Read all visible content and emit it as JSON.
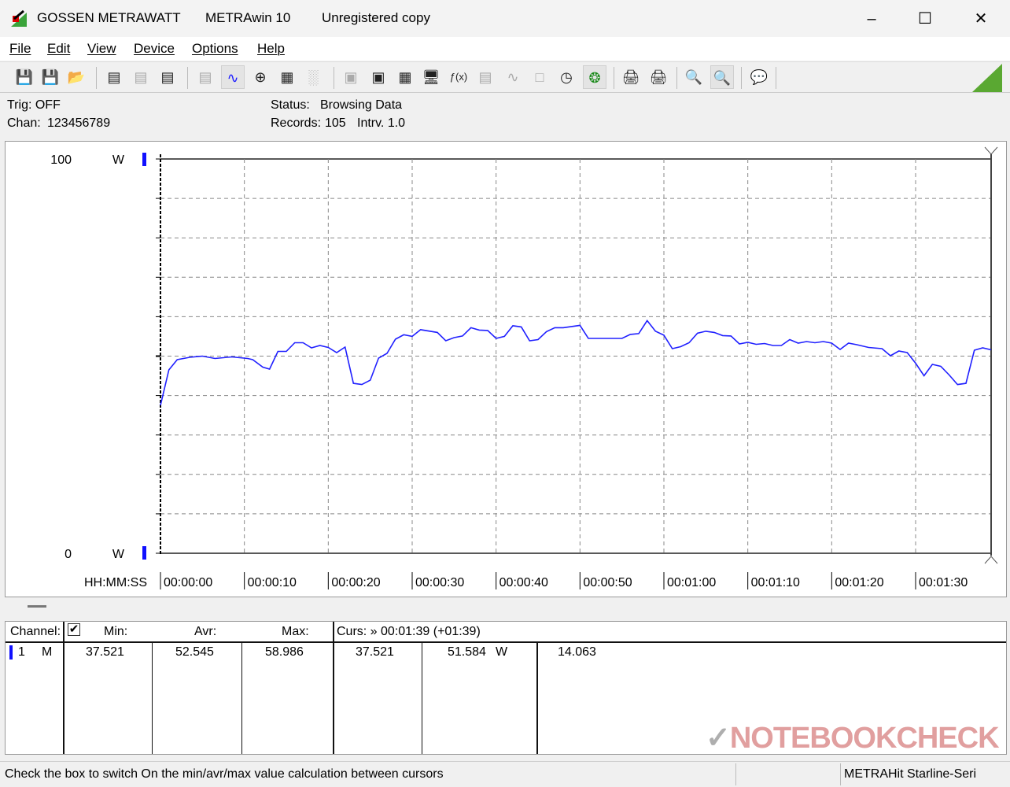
{
  "window": {
    "title_parts": [
      "GOSSEN METRAWATT",
      "METRAwin 10",
      "Unregistered copy"
    ],
    "controls": [
      "minimize",
      "maximize",
      "close"
    ]
  },
  "menu": [
    "File",
    "Edit",
    "View",
    "Device",
    "Options",
    "Help"
  ],
  "toolbar": {
    "icons": [
      "save-icon",
      "save-as-icon",
      "open-folder-icon",
      "device-read-icon",
      "device-transfer-icon",
      "device-memory-icon",
      "display-icon",
      "waveform-view-icon",
      "crosshair-icon",
      "table-view-icon",
      "bar-view-icon",
      "device-settings-icon",
      "device-upload-icon",
      "interface-icon",
      "computer-icon",
      "function-icon",
      "device-disabled-icon",
      "sine-icon",
      "pulse-icon",
      "clock-icon",
      "trigger-icon",
      "print-preview-icon",
      "print-icon",
      "zoom-data-icon",
      "zoom-signal-icon",
      "comment-icon"
    ],
    "accent": "#5aa832"
  },
  "info": {
    "trig": "Trig: OFF",
    "chan_label": "Chan:",
    "chan_value": "123456789",
    "status_label": "Status:",
    "status_value": "Browsing Data",
    "records_label": "Records:",
    "records_value": "105",
    "interval": "Intrv. 1.0"
  },
  "chart_data": {
    "type": "line",
    "ylabel_top": "100",
    "ylabel_bottom": "0",
    "unit": "W",
    "xlabel": "HH:MM:SS",
    "x_ticks": [
      "00:00:00",
      "00:00:10",
      "00:00:20",
      "00:00:30",
      "00:00:40",
      "00:00:50",
      "00:01:00",
      "00:01:10",
      "00:01:20",
      "00:01:30"
    ],
    "xlim": [
      0,
      99
    ],
    "ylim": [
      0,
      100
    ],
    "grid": true,
    "series_color": "#2020ff",
    "x": [
      0,
      1,
      2,
      3.5,
      5,
      6.5,
      8.5,
      10.4,
      11,
      12.2,
      13,
      14,
      15,
      16,
      17,
      18,
      19,
      20,
      21,
      22,
      23,
      24,
      25,
      26,
      27,
      28,
      29,
      30,
      31,
      33,
      34,
      35,
      36,
      37,
      38,
      39,
      40,
      41,
      42,
      43,
      44,
      45,
      46,
      47,
      48,
      50,
      51,
      55,
      56,
      57,
      58,
      59,
      60,
      61,
      62,
      63,
      64,
      65,
      66,
      67,
      68,
      69,
      70,
      71,
      72,
      73,
      74,
      75,
      76,
      77,
      78,
      79,
      80,
      81,
      82,
      83,
      84.4,
      86,
      87,
      88,
      89,
      90,
      91,
      92,
      93,
      94,
      95,
      96,
      97,
      98,
      99
    ],
    "y": [
      37.5,
      46.5,
      49.1,
      49.7,
      50.0,
      49.4,
      49.8,
      49.4,
      49.1,
      47.2,
      46.7,
      51.2,
      51.2,
      53.4,
      53.4,
      52.1,
      52.7,
      52.2,
      50.9,
      52.3,
      43.1,
      42.8,
      43.9,
      49.5,
      50.7,
      54.3,
      55.4,
      55.0,
      56.7,
      56.0,
      53.9,
      54.7,
      55.1,
      57.2,
      56.6,
      56.5,
      54.5,
      55.0,
      57.7,
      57.4,
      53.9,
      54.2,
      56.2,
      57.2,
      57.2,
      57.8,
      54.5,
      54.5,
      55.5,
      55.7,
      59.0,
      56.3,
      55.3,
      51.9,
      52.4,
      53.4,
      55.8,
      56.3,
      56.0,
      55.2,
      55.1,
      53.1,
      53.5,
      53.0,
      53.2,
      52.7,
      52.7,
      54.2,
      53.3,
      53.7,
      53.4,
      53.7,
      53.3,
      51.7,
      53.3,
      52.9,
      52.2,
      51.9,
      50.1,
      51.3,
      50.9,
      48.2,
      45.0,
      47.9,
      47.4,
      45.2,
      42.8,
      43.1,
      51.5,
      52.1,
      51.6
    ]
  },
  "table": {
    "headers": {
      "channel": "Channel:",
      "min": "Min:",
      "avr": "Avr:",
      "max": "Max:",
      "cursor": "Curs: » 00:01:39 (+01:39)"
    },
    "checkbox_checked": true,
    "row": {
      "channel": "1",
      "mode": "M",
      "min": "37.521",
      "avr": "52.545",
      "max": "58.986",
      "curs_a": "37.521",
      "curs_b": "51.584",
      "unit": "W",
      "extra": "14.063"
    }
  },
  "statusbar": {
    "hint": "Check the box to switch On the min/avr/max value calculation between cursors",
    "device": "METRAHit Starline-Seri"
  },
  "watermark": "NOTEBOOKCHECK"
}
